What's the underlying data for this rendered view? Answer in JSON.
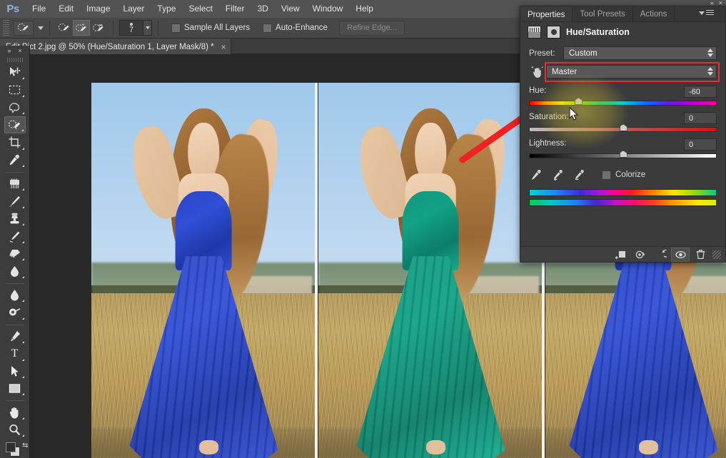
{
  "app": {
    "logo": "Ps",
    "menu": [
      "File",
      "Edit",
      "Image",
      "Layer",
      "Type",
      "Select",
      "Filter",
      "3D",
      "View",
      "Window",
      "Help"
    ]
  },
  "options_bar": {
    "tool": "quick-selection-tool",
    "brush_size": "7",
    "modes": [
      "new-selection",
      "add-to-selection",
      "subtract-from-selection"
    ],
    "active_mode": "add-to-selection",
    "sample_all_layers_label": "Sample All Layers",
    "sample_all_layers_checked": false,
    "auto_enhance_label": "Auto-Enhance",
    "auto_enhance_checked": false,
    "refine_edge_label": "Refine Edge...",
    "refine_edge_enabled": false
  },
  "document": {
    "tab_title": "Edit Pict 2.jpg @ 50% (Hue/Saturation 1, Layer Mask/8) *",
    "close_glyph": "×",
    "zoom": "50%",
    "filename": "Edit Pict 2.jpg",
    "layer": "Hue/Saturation 1, Layer Mask/8",
    "modified": true
  },
  "toolbar": {
    "collapse_glyph": "»",
    "close_glyph": "×",
    "tools": [
      {
        "name": "move-tool",
        "active": false
      },
      {
        "name": "rectangular-marquee-tool",
        "active": false
      },
      {
        "name": "lasso-tool",
        "active": false
      },
      {
        "name": "quick-selection-tool",
        "active": true
      },
      {
        "name": "crop-tool",
        "active": false
      },
      {
        "name": "eyedropper-tool",
        "active": false
      },
      {
        "name": "spot-healing-brush-tool",
        "active": false
      },
      {
        "name": "brush-tool",
        "active": false
      },
      {
        "name": "clone-stamp-tool",
        "active": false
      },
      {
        "name": "history-brush-tool",
        "active": false
      },
      {
        "name": "eraser-tool",
        "active": false
      },
      {
        "name": "gradient-tool",
        "active": false
      },
      {
        "name": "blur-tool",
        "active": false
      },
      {
        "name": "dodge-tool",
        "active": false
      },
      {
        "name": "pen-tool",
        "active": false
      },
      {
        "name": "type-tool",
        "active": false,
        "glyph": "T"
      },
      {
        "name": "path-selection-tool",
        "active": false
      },
      {
        "name": "rectangle-tool",
        "active": false
      },
      {
        "name": "hand-tool",
        "active": false
      },
      {
        "name": "zoom-tool",
        "active": false
      }
    ]
  },
  "canvas": {
    "images": [
      {
        "name": "original-blue-dress-image",
        "variant": "blue",
        "alt": "Woman in blue dress in field"
      },
      {
        "name": "edited-teal-dress-image",
        "variant": "teal",
        "alt": "Woman in teal dress after hue shift"
      },
      {
        "name": "third-blue-dress-image",
        "variant": "blue",
        "alt": "Blue dress detail partially hidden by panel"
      }
    ],
    "annotation": {
      "name": "red-arrow",
      "color": "#ee2222",
      "points_to": "hue-slider"
    }
  },
  "properties_panel": {
    "tabs": [
      {
        "label": "Properties",
        "active": true
      },
      {
        "label": "Tool Presets",
        "active": false
      },
      {
        "label": "Actions",
        "active": false
      }
    ],
    "collapse_glyph": "»",
    "close_glyph": "×",
    "title": "Hue/Saturation",
    "preset_label": "Preset:",
    "preset_value": "Custom",
    "channel_value": "Master",
    "channel_highlight_color": "#ef2b2b",
    "hue_label": "Hue:",
    "hue_value": "-60",
    "hue_percent": 26,
    "saturation_label": "Saturation:",
    "saturation_value": "0",
    "saturation_percent": 50,
    "lightness_label": "Lightness:",
    "lightness_value": "0",
    "lightness_percent": 50,
    "eyedroppers": [
      "eyedropper-sample",
      "eyedropper-add",
      "eyedropper-subtract"
    ],
    "colorize_label": "Colorize",
    "colorize_checked": false,
    "footer_buttons": [
      "clip-to-layer-icon",
      "view-previous-state-icon",
      "reset-adjustment-icon",
      "toggle-layer-visibility-icon",
      "delete-adjustment-layer-icon"
    ]
  }
}
